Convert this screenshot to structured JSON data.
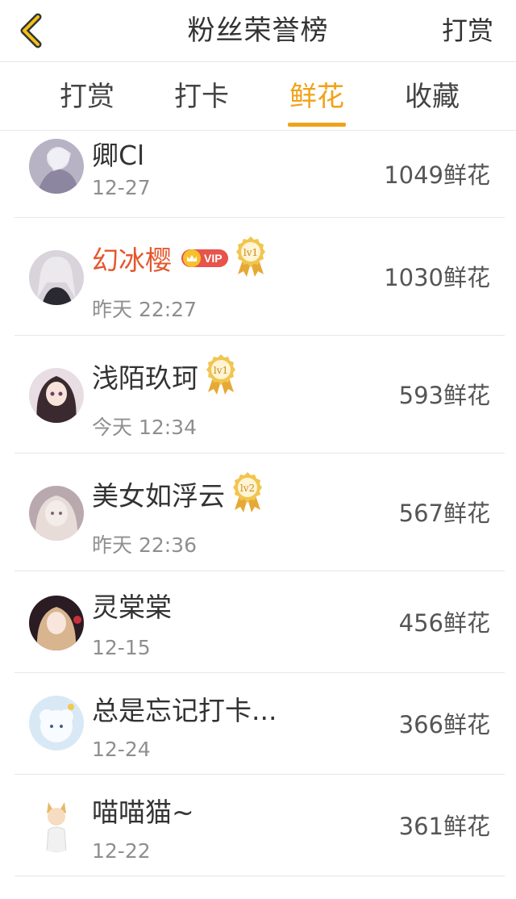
{
  "header": {
    "back_icon": "chevron-left-icon",
    "title": "粉丝荣誉榜",
    "action_label": "打赏"
  },
  "colors": {
    "accent": "#f0a21a",
    "vip_name": "#e4572e",
    "vip_badge": "#e8534a",
    "medal_gold": "#e9b441"
  },
  "tabs": [
    {
      "label": "打赏",
      "active": false
    },
    {
      "label": "打卡",
      "active": false
    },
    {
      "label": "鲜花",
      "active": true
    },
    {
      "label": "收藏",
      "active": false
    }
  ],
  "fans": [
    {
      "name": "卿Cl",
      "time": "12-27",
      "amount": "1049鲜花",
      "vip": false,
      "level": ""
    },
    {
      "name": "幻冰樱",
      "time": "昨天 22:27",
      "amount": "1030鲜花",
      "vip": true,
      "vip_label": "VIP",
      "level": "lv1"
    },
    {
      "name": "浅陌玖珂",
      "time": "今天 12:34",
      "amount": "593鲜花",
      "vip": false,
      "level": "lv1"
    },
    {
      "name": "美女如浮云",
      "time": "昨天 22:36",
      "amount": "567鲜花",
      "vip": false,
      "level": "lv2"
    },
    {
      "name": "灵棠棠",
      "time": "12-15",
      "amount": "456鲜花",
      "vip": false,
      "level": ""
    },
    {
      "name": "总是忘记打卡...",
      "time": "12-24",
      "amount": "366鲜花",
      "vip": false,
      "level": ""
    },
    {
      "name": "喵喵猫~",
      "time": "12-22",
      "amount": "361鲜花",
      "vip": false,
      "level": ""
    }
  ]
}
